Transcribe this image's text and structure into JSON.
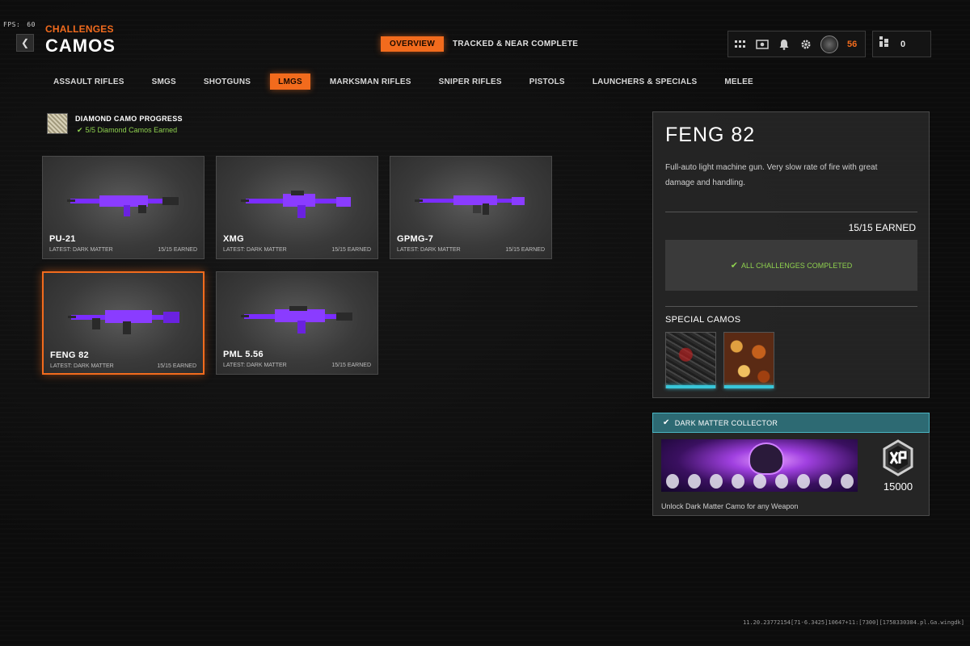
{
  "hud": {
    "fps_label": "FPS:",
    "fps_value": "60"
  },
  "header": {
    "breadcrumb": "CHALLENGES",
    "title": "CAMOS"
  },
  "top_tabs": [
    {
      "label": "OVERVIEW",
      "active": true
    },
    {
      "label": "TRACKED & NEAR COMPLETE",
      "active": false
    }
  ],
  "status": {
    "rank_level": "56",
    "friends_online": "0"
  },
  "categories": [
    {
      "label": "ASSAULT RIFLES"
    },
    {
      "label": "SMGS"
    },
    {
      "label": "SHOTGUNS"
    },
    {
      "label": "LMGS",
      "active": true
    },
    {
      "label": "MARKSMAN RIFLES"
    },
    {
      "label": "SNIPER RIFLES"
    },
    {
      "label": "PISTOLS"
    },
    {
      "label": "LAUNCHERS & SPECIALS"
    },
    {
      "label": "MELEE"
    }
  ],
  "diamond": {
    "title": "DIAMOND CAMO PROGRESS",
    "progress": "5/5 Diamond Camos Earned"
  },
  "weapons": [
    {
      "name": "PU-21",
      "latest": "LATEST: DARK MATTER",
      "earned": "15/15 EARNED"
    },
    {
      "name": "XMG",
      "latest": "LATEST: DARK MATTER",
      "earned": "15/15 EARNED"
    },
    {
      "name": "GPMG-7",
      "latest": "LATEST: DARK MATTER",
      "earned": "15/15 EARNED"
    },
    {
      "name": "FENG 82",
      "latest": "LATEST: DARK MATTER",
      "earned": "15/15 EARNED",
      "selected": true
    },
    {
      "name": "PML 5.56",
      "latest": "LATEST: DARK MATTER",
      "earned": "15/15 EARNED"
    }
  ],
  "detail": {
    "name": "FENG 82",
    "description": "Full-auto light machine gun.  Very slow rate of fire with great damage and handling.",
    "earned_total": "15/15 EARNED",
    "complete_text": "ALL CHALLENGES COMPLETED",
    "special_title": "SPECIAL CAMOS"
  },
  "reward": {
    "title": "DARK MATTER COLLECTOR",
    "xp_value": "15000",
    "description": "Unlock Dark Matter Camo for any Weapon"
  },
  "build_string": "11.20.23772154[71-6.3425]10647+11:[7300][1758330384.pl.Ga.wingdk]",
  "colors": {
    "accent": "#f26b1d",
    "success": "#8fd14f",
    "teal": "#38c6d9",
    "camo_purple": "#7b2cff"
  },
  "icons": [
    "back-chevron-icon",
    "grid-icon",
    "menu-card-icon",
    "bell-icon",
    "gear-icon",
    "rank-badge-icon",
    "friends-icon",
    "checkmark-icon",
    "xp-hexagon-icon"
  ]
}
